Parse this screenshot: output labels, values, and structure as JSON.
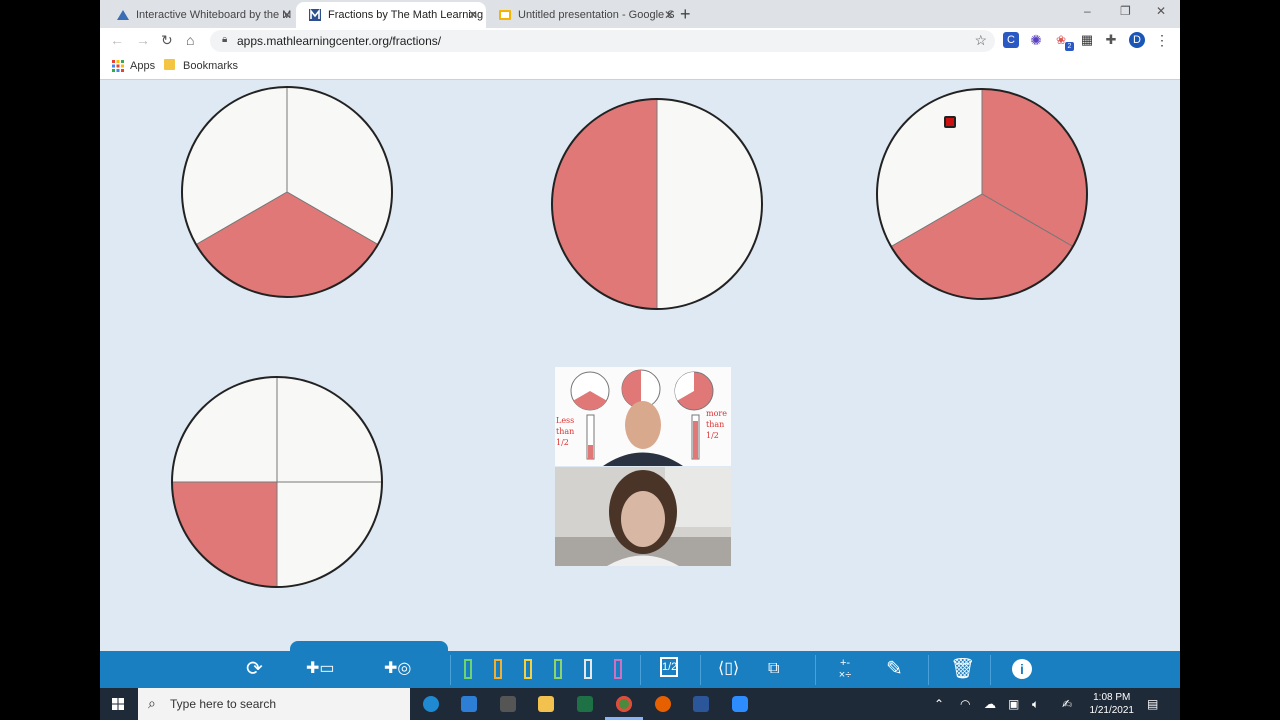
{
  "browser": {
    "tabs": [
      {
        "title": "Interactive Whiteboard by the M",
        "icon": "mlc-icon",
        "active": false
      },
      {
        "title": "Fractions by The Math Learning C",
        "icon": "mlc-icon",
        "active": true
      },
      {
        "title": "Untitled presentation - Google S",
        "icon": "slides-icon",
        "active": false
      }
    ],
    "new_tab": "+",
    "window_controls": [
      "–",
      "❐",
      "✕"
    ],
    "url": "apps.mathlearningcenter.org/fractions/",
    "bookmarks": {
      "apps": "Apps",
      "bookmarks": "Bookmarks"
    },
    "profile_initial": "D",
    "ext_badge": "2"
  },
  "fractions": [
    {
      "parts": 3,
      "shaded": [
        1
      ]
    },
    {
      "parts": 2,
      "shaded": [
        1
      ]
    },
    {
      "parts": 3,
      "shaded": [
        0,
        1
      ]
    },
    {
      "parts": 4,
      "shaded": [
        2
      ]
    }
  ],
  "colors": {
    "shade": "#e07878",
    "empty": "#f8f8f6",
    "outline": "#222222",
    "divider": "#777777",
    "toolbar": "#1a7fc1"
  },
  "video": {
    "handwriting_left": "Less than 1/2",
    "handwriting_right": "more than 1/2"
  },
  "toolbar": {
    "buttons": [
      "reset-icon",
      "add-bar-icon",
      "add-circle-icon",
      "bar-1-icon",
      "bar-2-icon",
      "bar-3-icon",
      "bar-4-icon",
      "bar-5-icon",
      "bar-6-icon",
      "fraction-label-icon",
      "split-icon",
      "compare-icon",
      "operations-icon",
      "pencil-icon",
      "trash-icon",
      "info-icon"
    ],
    "fraction_label": "1/2",
    "ops": "+-×÷"
  },
  "taskbar": {
    "search_placeholder": "Type here to search",
    "time": "1:08 PM",
    "date": "1/21/2021"
  }
}
